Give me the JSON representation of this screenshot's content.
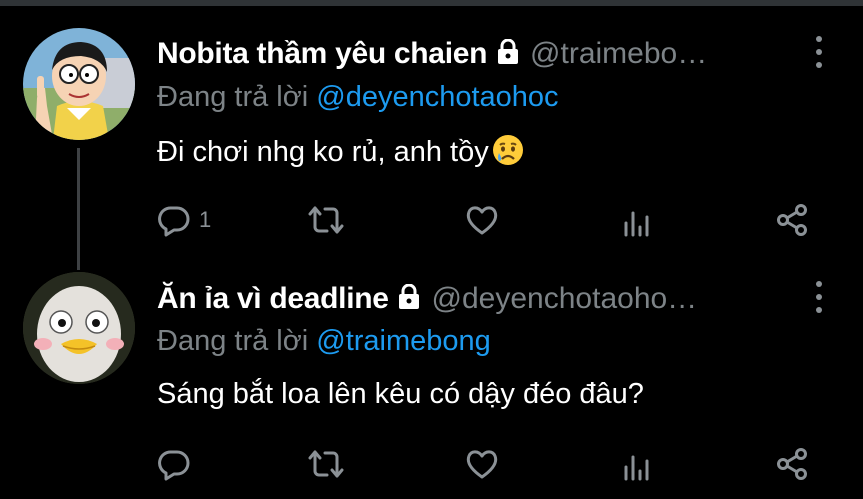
{
  "tweets": [
    {
      "display_name": "Nobita thầm yêu chaien",
      "handle": "@traimebo…",
      "replying_prefix": "Đang trả lời ",
      "replying_to": "@deyenchotaohoc",
      "text": "Đi chơi nhg ko rủ, anh tồy",
      "emoji": "crying-face",
      "reply_count": "1",
      "locked": true
    },
    {
      "display_name": "Ăn ỉa vì deadline",
      "handle": "@deyenchotaoho…",
      "replying_prefix": "Đang trả lời ",
      "replying_to": "@traimebong",
      "text": "Sáng bắt loa lên kêu có dậy đéo đâu?",
      "reply_count": "",
      "locked": true
    }
  ],
  "colors": {
    "background": "#000000",
    "text": "#e7e9ea",
    "secondary": "#7d8387",
    "link": "#1d9bf0",
    "thread_line": "#3e4144"
  },
  "icons": [
    "reply-icon",
    "retweet-icon",
    "like-icon",
    "analytics-icon",
    "share-icon",
    "more-icon",
    "lock-icon"
  ]
}
